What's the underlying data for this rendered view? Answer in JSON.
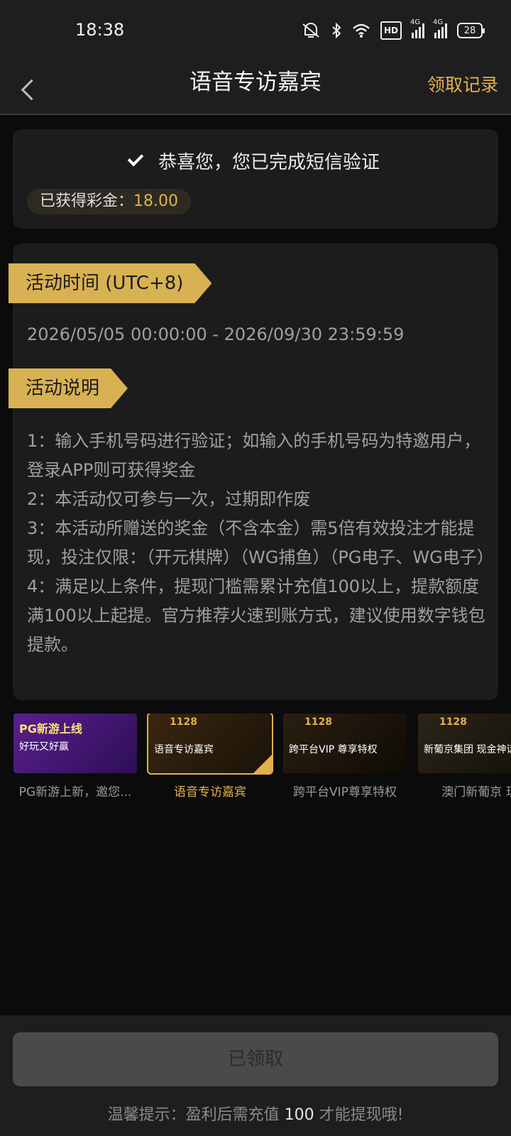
{
  "status_bar": {
    "time": "18:38",
    "icons": [
      "mute-icon",
      "bluetooth-icon",
      "wifi-icon",
      "hd-icon",
      "signal-icon",
      "signal-icon",
      "battery-icon"
    ],
    "hd_label": "HD",
    "network1": "4G",
    "network2": "4G",
    "battery": "28"
  },
  "nav": {
    "title": "语音专访嘉宾",
    "right_link": "领取记录"
  },
  "verify_card": {
    "message": "恭喜您，您已完成短信验证",
    "bonus_label": "已获得彩金：",
    "bonus_value": "18.00"
  },
  "activity": {
    "time_heading": "活动时间 (UTC+8)",
    "time_range": "2026/05/05 00:00:00 - 2026/09/30 23:59:59",
    "desc_heading": "活动说明",
    "desc_lines": [
      "1：输入手机号码进行验证；如输入的手机号码为特邀用户，登录APP则可获得奖金",
      "2：本活动仅可参与一次，过期即作废",
      "3：本活动所赠送的奖金（不含本金）需5倍有效投注才能提现，投注仅限：（开元棋牌）（WG捕鱼）（PG电子、WG电子）",
      "4：满足以上条件，提现门槛需累计充值100以上，提款额度满100以上起提。官方推荐火速到账方式，建议使用数字钱包提款。"
    ]
  },
  "carousel": {
    "items": [
      {
        "caption": "PG新游上新，邀您...",
        "banner_title": "PG新游上线",
        "banner_sub": "好玩又好赢"
      },
      {
        "caption": "语音专访嘉宾",
        "banner_title": "1128",
        "banner_sub": "语音专访嘉宾"
      },
      {
        "caption": "跨平台VIP尊享特权",
        "banner_title": "1128",
        "banner_sub": "跨平台VIP 尊享特权"
      },
      {
        "caption": "澳门新葡京 现",
        "banner_title": "1128",
        "banner_sub": "新葡京集团 现金神话"
      }
    ],
    "active_index": 1
  },
  "footer": {
    "claim_button": "已领取",
    "tip_prefix": "温馨提示：盈利后需充值",
    "tip_num": "100",
    "tip_suffix": "才能提现哦!"
  },
  "colors": {
    "accent": "#e2b14e",
    "ribbon": "#d8b153",
    "background": "#0b0b0b",
    "card": "#1c1c1c"
  }
}
